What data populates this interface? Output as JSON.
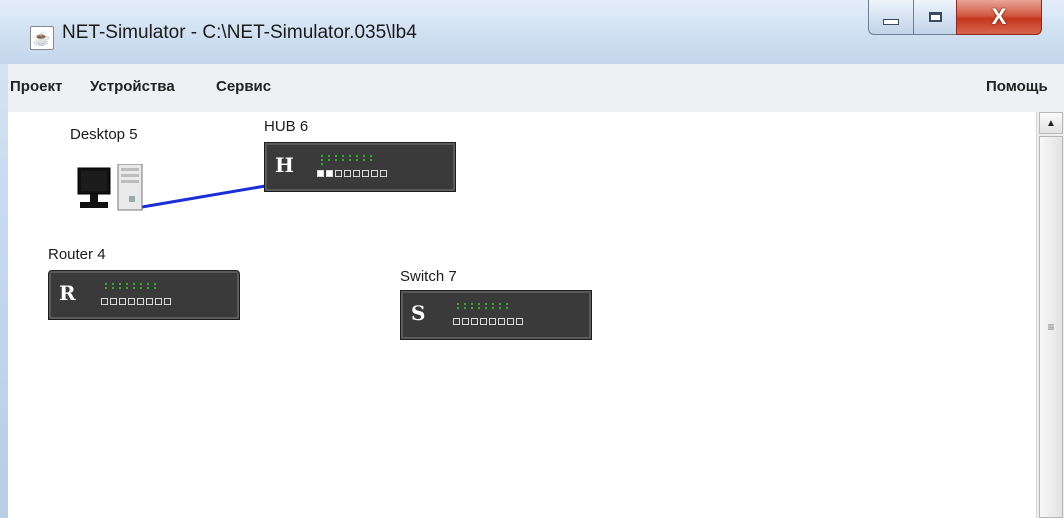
{
  "window": {
    "title": "NET-Simulator - C:\\NET-Simulator.035\\lb4",
    "app_icon": "java-cup-icon",
    "controls": {
      "close_label": "X"
    }
  },
  "menu": {
    "items": [
      "Проект",
      "Устройства",
      "Сервис"
    ],
    "help": "Помощь"
  },
  "devices": [
    {
      "id": "desktop",
      "label": "Desktop 5",
      "type": "desktop"
    },
    {
      "id": "hub",
      "label": "HUB 6",
      "type": "hub",
      "letter": "H"
    },
    {
      "id": "router",
      "label": "Router 4",
      "type": "router",
      "letter": "R"
    },
    {
      "id": "switch",
      "label": "Switch 7",
      "type": "switch",
      "letter": "S"
    }
  ],
  "links": [
    {
      "from": "Desktop 5",
      "to": "HUB 6",
      "color": "#1a2fd6"
    }
  ],
  "colors": {
    "device_body": "#3a3a3a",
    "led": "#2fae2f",
    "link": "#1a2fd6",
    "close_button": "#c4361e"
  }
}
